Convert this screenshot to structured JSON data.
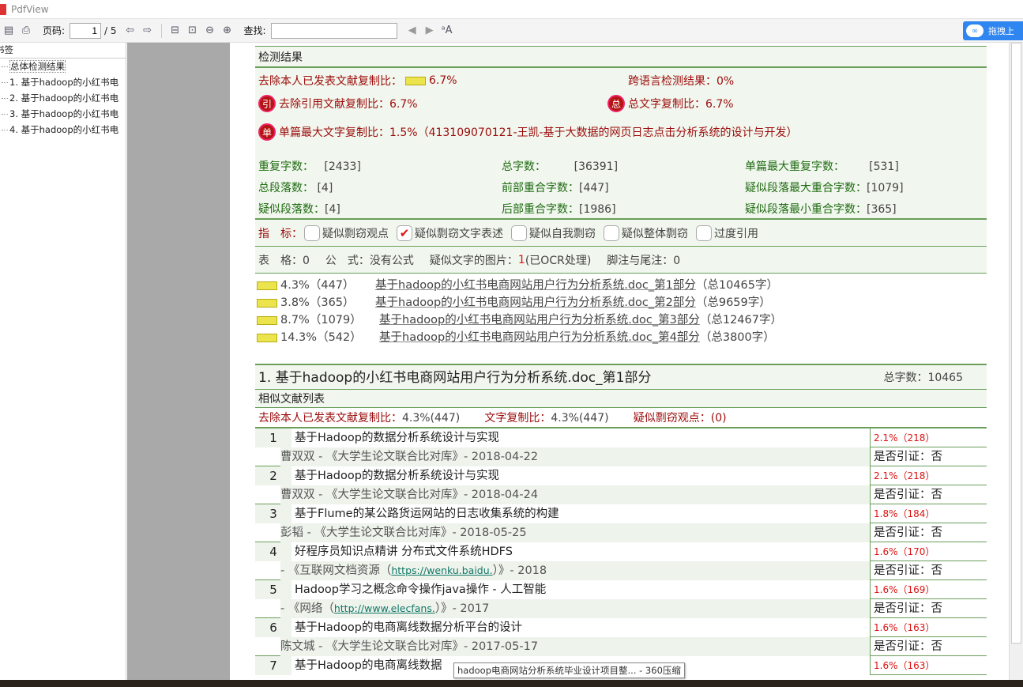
{
  "window": {
    "title": "PdfView"
  },
  "toolbar": {
    "page_label": "页码:",
    "page_value": "1",
    "page_total": "/ 5",
    "find_label": "查找:",
    "find_value": "",
    "baidu_label": "拖拽上"
  },
  "sidebar": {
    "header": "书签",
    "items": [
      {
        "label": "总体检测结果"
      },
      {
        "label": "1. 基于hadoop的小红书电"
      },
      {
        "label": "2. 基于hadoop的小红书电"
      },
      {
        "label": "3. 基于hadoop的小红书电"
      },
      {
        "label": "4. 基于hadoop的小红书电"
      }
    ]
  },
  "report": {
    "section_title": "检测结果",
    "excl_self": "去除本人已发表文献复制比：",
    "excl_self_val": "6.7%",
    "cross_lang": "跨语言检测结果：0%",
    "excl_cite": "去除引用文献复制比：6.7%",
    "total_copy": "总文字复制比：6.7%",
    "single_max": "单篇最大文字复制比：1.5%（413109070121-王凯-基于大数据的网页日志点击分析系统的设计与开发）",
    "badge_cite": "引",
    "badge_total": "总",
    "badge_single": "单",
    "stats": [
      {
        "k": "重复字数：",
        "v": "[2433]"
      },
      {
        "k": "总字数：",
        "v": "[36391]"
      },
      {
        "k": "单篇最大重复字数：",
        "v": "[531]"
      },
      {
        "k": "总段落数：",
        "v": "[4]"
      },
      {
        "k": "前部重合字数：",
        "v": "[447]"
      },
      {
        "k": "疑似段落最大重合字数：",
        "v": "[1079]"
      },
      {
        "k": "疑似段落数：",
        "v": "[4]"
      },
      {
        "k": "后部重合字数：",
        "v": "[1986]"
      },
      {
        "k": "疑似段落最小重合字数：",
        "v": "[365]"
      }
    ],
    "indicator_label": "指　标：",
    "indicators": [
      {
        "label": "疑似剽窃观点",
        "checked": false
      },
      {
        "label": "疑似剽窃文字表述",
        "checked": true
      },
      {
        "label": "疑似自我剽窃",
        "checked": false
      },
      {
        "label": "疑似整体剽窃",
        "checked": false
      },
      {
        "label": "过度引用",
        "checked": false
      }
    ],
    "misc": {
      "table": "表　格：0",
      "formula": "公　式：没有公式",
      "images_prefix": "疑似文字的图片：",
      "images_count": "1",
      "images_suffix": "(已OCR处理)",
      "footnote": "脚注与尾注：0"
    },
    "parts": [
      {
        "pct": "4.3%（447）",
        "name": "基于hadoop的小红书电商网站用户行为分析系统.doc_第1部分",
        "total": "（总10465字）"
      },
      {
        "pct": "3.8%（365）",
        "name": "基于hadoop的小红书电商网站用户行为分析系统.doc_第2部分",
        "total": "（总9659字）"
      },
      {
        "pct": "8.7%（1079）",
        "name": "基于hadoop的小红书电商网站用户行为分析系统.doc_第3部分",
        "total": "（总12467字）"
      },
      {
        "pct": "14.3%（542）",
        "name": "基于hadoop的小红书电商网站用户行为分析系统.doc_第4部分",
        "total": "（总3800字）"
      }
    ],
    "doc_title": "1. 基于hadoop的小红书电商网站用户行为分析系统.doc_第1部分",
    "doc_total": "总字数：10465",
    "sim_header": "相似文献列表",
    "sim_sum_a": "去除本人已发表文献复制比：",
    "sim_sum_a_val": "4.3%(447)",
    "sim_sum_b": "文字复制比：",
    "sim_sum_b_val": "4.3%(447)",
    "sim_sum_c": "疑似剽窃观点：(0)",
    "refs": [
      {
        "no": "1",
        "title": "基于Hadoop的数据分析系统设计与实现",
        "src_pre": "曹双双 - 《大学生论文联合比对库》- 2018-04-22",
        "link": "",
        "src_post": "",
        "pct": "2.1%（218）",
        "cite": "是否引证：否"
      },
      {
        "no": "2",
        "title": "基于Hadoop的数据分析系统设计与实现",
        "src_pre": "曹双双 - 《大学生论文联合比对库》- 2018-04-24",
        "link": "",
        "src_post": "",
        "pct": "2.1%（218）",
        "cite": "是否引证：否"
      },
      {
        "no": "3",
        "title": "基于Flume的某公路货运网站的日志收集系统的构建",
        "src_pre": "彭韬 - 《大学生论文联合比对库》- 2018-05-25",
        "link": "",
        "src_post": "",
        "pct": "1.8%（184）",
        "cite": "是否引证：否"
      },
      {
        "no": "4",
        "title": "好程序员知识点精讲 分布式文件系统HDFS",
        "src_pre": " - 《互联网文档资源（",
        "link": "https://wenku.baidu.",
        "src_post": "）》- 2018",
        "pct": "1.6%（170）",
        "cite": "是否引证：否"
      },
      {
        "no": "5",
        "title": "Hadoop学习之概念命令操作java操作 - 人工智能",
        "src_pre": " - 《网络（",
        "link": "http://www.elecfans.",
        "src_post": "）》- 2017",
        "pct": "1.6%（169）",
        "cite": "是否引证：否"
      },
      {
        "no": "6",
        "title": "基于Hadoop的电商离线数据分析平台的设计",
        "src_pre": "陈文城 - 《大学生论文联合比对库》- 2017-05-17",
        "link": "",
        "src_post": "",
        "pct": "1.6%（163）",
        "cite": "是否引证：否"
      },
      {
        "no": "7",
        "title": "基于Hadoop的电商离线数据",
        "src_pre": "",
        "link": "",
        "src_post": "",
        "pct": "1.6%（163）",
        "cite": ""
      }
    ]
  },
  "tooltip": "hadoop电商网站分析系统毕业设计项目整... - 360压缩"
}
